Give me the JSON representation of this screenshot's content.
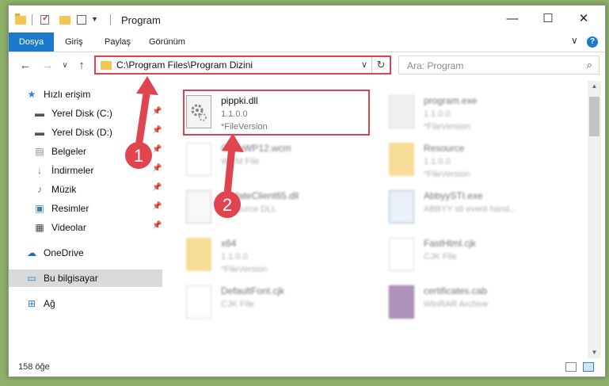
{
  "window": {
    "title": "Program"
  },
  "captions": {
    "minimize": "—",
    "maximize": "☐",
    "close": "✕"
  },
  "menu": {
    "file": "Dosya",
    "home": "Giriş",
    "share": "Paylaş",
    "view": "Görünüm",
    "expand": "∨",
    "help": "?"
  },
  "nav": {
    "back": "←",
    "forward": "→",
    "history": "∨",
    "up": "↑"
  },
  "address": {
    "path": "C:\\Program Files\\Program Dizini",
    "dropdown": "∨",
    "refresh": "↻"
  },
  "search": {
    "placeholder": "Ara: Program",
    "icon": "⌕"
  },
  "sidebar": {
    "items": [
      {
        "label": "Hızlı erişim",
        "icon": "star-icon",
        "glyph": "★",
        "color": "#2e7fd4",
        "pinned": false
      },
      {
        "label": "Yerel Disk (C:)",
        "icon": "drive-icon",
        "glyph": "▬",
        "color": "#555555",
        "pinned": true
      },
      {
        "label": "Yerel Disk (D:)",
        "icon": "drive-icon",
        "glyph": "▬",
        "color": "#555555",
        "pinned": true
      },
      {
        "label": "Belgeler",
        "icon": "documents-icon",
        "glyph": "▤",
        "color": "#7a8b9c",
        "pinned": true
      },
      {
        "label": "İndirmeler",
        "icon": "downloads-icon",
        "glyph": "↓",
        "color": "#2e7fd4",
        "pinned": true
      },
      {
        "label": "Müzik",
        "icon": "music-icon",
        "glyph": "♪",
        "color": "#2e7fd4",
        "pinned": true
      },
      {
        "label": "Resimler",
        "icon": "pictures-icon",
        "glyph": "▣",
        "color": "#3a7fb8",
        "pinned": true
      },
      {
        "label": "Videolar",
        "icon": "videos-icon",
        "glyph": "▦",
        "color": "#444444",
        "pinned": true
      },
      {
        "label": "OneDrive",
        "icon": "cloud-icon",
        "glyph": "☁",
        "color": "#1b6fc2",
        "pinned": false
      },
      {
        "label": "Bu bilgisayar",
        "icon": "computer-icon",
        "glyph": "▭",
        "color": "#2a7ab8",
        "pinned": false
      },
      {
        "label": "Ağ",
        "icon": "network-icon",
        "glyph": "⊞",
        "color": "#2a7ab8",
        "pinned": false
      }
    ],
    "pin_glyph": "📌"
  },
  "files": [
    {
      "name": "pippki.dll",
      "sub1": "1.1.0.0",
      "sub2": "*FileVersion",
      "icon": "dll-gear-icon"
    },
    {
      "name": "program.exe",
      "sub1": "1.1.0.0",
      "sub2": "*FileVersion",
      "icon": "exe-icon"
    },
    {
      "name": "GifToWP12.wcm",
      "sub1": "WCM File",
      "sub2": "",
      "icon": "document-icon"
    },
    {
      "name": "Resource",
      "sub1": "1.1.0.0",
      "sub2": "*FileVersion",
      "icon": "folder-icon"
    },
    {
      "name": "UpdateClient65.dll",
      "sub1": "Resource DLL",
      "sub2": "",
      "icon": "dll-gear-icon"
    },
    {
      "name": "AbbyySTI.exe",
      "sub1": "ABBYY sti event hand...",
      "sub2": "",
      "icon": "exe-window-icon"
    },
    {
      "name": "x64",
      "sub1": "1.1.0.0",
      "sub2": "*FileVersion",
      "icon": "folder-icon"
    },
    {
      "name": "FastHtml.cjk",
      "sub1": "CJK File",
      "sub2": "",
      "icon": "document-icon"
    },
    {
      "name": "DefaultFont.cjk",
      "sub1": "CJK File",
      "sub2": "",
      "icon": "document-icon"
    },
    {
      "name": "certificates.cab",
      "sub1": "WinRAR Archive",
      "sub2": "",
      "icon": "archive-icon"
    }
  ],
  "status": {
    "count": "158 öğe"
  },
  "annotations": {
    "step1": "1",
    "step2": "2"
  },
  "colors": {
    "accent": "#1979ca",
    "highlight": "#e04050",
    "annotation": "#e0454f"
  }
}
